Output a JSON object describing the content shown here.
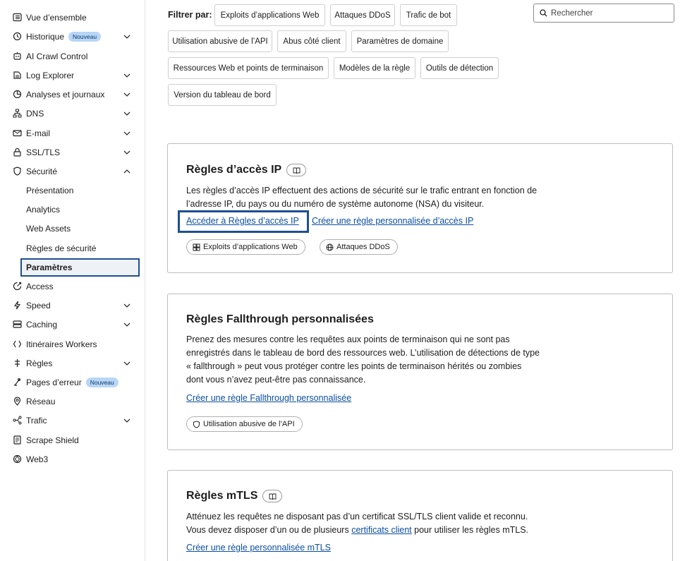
{
  "sidebar": {
    "items": [
      {
        "label": "Vue d’ensemble",
        "icon": "list-icon"
      },
      {
        "label": "Historique",
        "icon": "history-icon",
        "badge": "Nouveau",
        "chevron": "down"
      },
      {
        "label": "AI Crawl Control",
        "icon": "ai-crawl-icon"
      },
      {
        "label": "Log Explorer",
        "icon": "log-explorer-icon",
        "chevron": "down"
      },
      {
        "label": "Analyses et journaux",
        "icon": "analytics-icon",
        "chevron": "down"
      },
      {
        "label": "DNS",
        "icon": "dns-icon",
        "chevron": "down"
      },
      {
        "label": "E-mail",
        "icon": "email-icon",
        "chevron": "down"
      },
      {
        "label": "SSL/TLS",
        "icon": "lock-icon",
        "chevron": "down"
      },
      {
        "label": "Sécurité",
        "icon": "shield-icon",
        "chevron": "up"
      },
      {
        "label": "Access",
        "icon": "access-icon"
      },
      {
        "label": "Speed",
        "icon": "lightning-icon",
        "chevron": "down"
      },
      {
        "label": "Caching",
        "icon": "caching-icon",
        "chevron": "down"
      },
      {
        "label": "Itinéraires Workers",
        "icon": "workers-icon"
      },
      {
        "label": "Règles",
        "icon": "rules-icon",
        "chevron": "down"
      },
      {
        "label": "Pages d’erreur",
        "icon": "error-pages-icon",
        "badge": "Nouveau"
      },
      {
        "label": "Réseau",
        "icon": "network-icon"
      },
      {
        "label": "Trafic",
        "icon": "traffic-icon",
        "chevron": "down"
      },
      {
        "label": "Scrape Shield",
        "icon": "scrape-shield-icon"
      },
      {
        "label": "Web3",
        "icon": "web3-icon"
      }
    ],
    "security_sub": [
      "Présentation",
      "Analytics",
      "Web Assets",
      "Règles de sécurité",
      "Paramètres"
    ]
  },
  "filters": {
    "label": "Filtrer par:",
    "chips": [
      "Exploits d’applications Web",
      "Attaques DDoS",
      "Trafic de bot",
      "Utilisation abusive de l’API",
      "Abus côté client",
      "Paramètres de domaine",
      "Ressources Web et points de terminaison",
      "Modèles de la règle",
      "Outils de détection",
      "Version du tableau de bord"
    ]
  },
  "search": {
    "placeholder": "Rechercher"
  },
  "cards": {
    "ip": {
      "title": "Règles d’accès IP",
      "desc1": "Les règles d’accès IP effectuent des actions de sécurité sur le trafic entrant en fonction de",
      "desc2": "l’adresse IP, du pays ou du numéro de système autonome (NSA) du visiteur.",
      "link1": "Accéder à Règles d’accès IP",
      "link2": "Créer une règle personnalisée d’accès IP",
      "tags": [
        "Exploits d’applications Web",
        "Attaques DDoS"
      ]
    },
    "fallthrough": {
      "title": "Règles Fallthrough personnalisées",
      "desc1": "Prenez des mesures contre les requêtes aux points de terminaison qui ne sont pas",
      "desc2": "enregistrés dans le tableau de bord des ressources web. L’utilisation de détections de type",
      "desc3": "« fallthrough » peut vous protéger contre les points de terminaison hérités ou zombies",
      "desc4": "dont vous n’avez peut-être pas connaissance.",
      "link": "Créer une règle Fallthrough personnalisée",
      "tags": [
        "Utilisation abusive de l’API"
      ]
    },
    "mtls": {
      "title": "Règles mTLS",
      "desc1": "Atténuez les requêtes ne disposant pas d’un certificat SSL/TLS client valide et reconnu.",
      "desc2a": "Vous devez disposer d’un ou de plusieurs",
      "desc2link": "certificats client",
      "desc2b": "pour utiliser les règles mTLS.",
      "link": "Créer une règle personnalisée mTLS"
    }
  },
  "colors": {
    "accent": "#1e4f91",
    "link": "#0b4ea2",
    "badge_bg": "#b8d6f5"
  }
}
